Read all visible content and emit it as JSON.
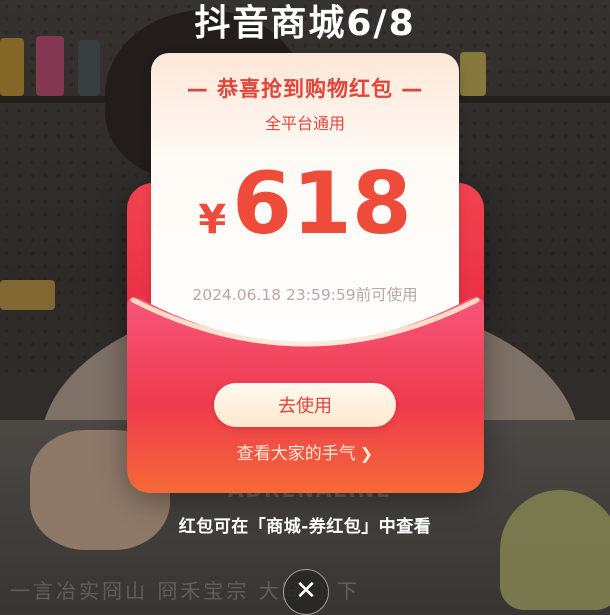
{
  "banner": {
    "title": "抖音商城6/8"
  },
  "redpacket": {
    "title": "— 恭喜抢到购物红包 —",
    "subtitle": "全平台通用",
    "currency": "¥",
    "amount": "618",
    "expiry": "2024.06.18 23:59:59前可使用",
    "use_button": "去使用",
    "view_luck_link": "查看大家的手气",
    "view_luck_chevron": "chevron-right-icon"
  },
  "hint": "红包可在「商城-券红包」中查看",
  "close_button": {
    "icon": "close-icon",
    "glyph": "✕"
  },
  "background": {
    "shirt_text": "ADRENALINE",
    "subtitle_text": "一言冶实冏山 冏禾宝宗 大冏门 下"
  },
  "colors": {
    "accent_red": "#e0443a",
    "envelope_red": "#e52940",
    "card_bg": "#fffaf5"
  }
}
